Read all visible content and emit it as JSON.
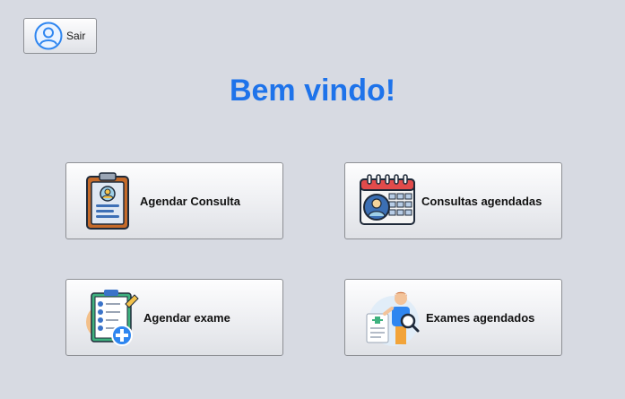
{
  "header": {
    "logout_label": "Sair",
    "logout_icon": "user-circle-icon",
    "welcome": "Bem vindo!"
  },
  "menu": {
    "schedule_appointment": {
      "label": "Agendar Consulta",
      "icon": "id-card-clipboard-icon"
    },
    "scheduled_appointments": {
      "label": "Consultas agendadas",
      "icon": "calendar-user-icon"
    },
    "schedule_exam": {
      "label": "Agendar exame",
      "icon": "checklist-clipboard-plus-icon"
    },
    "scheduled_exams": {
      "label": "Exames agendados",
      "icon": "doctor-magnifier-icon"
    }
  },
  "colors": {
    "background": "#d7dae2",
    "title": "#1e73ea",
    "button_border": "#8d8f94"
  }
}
